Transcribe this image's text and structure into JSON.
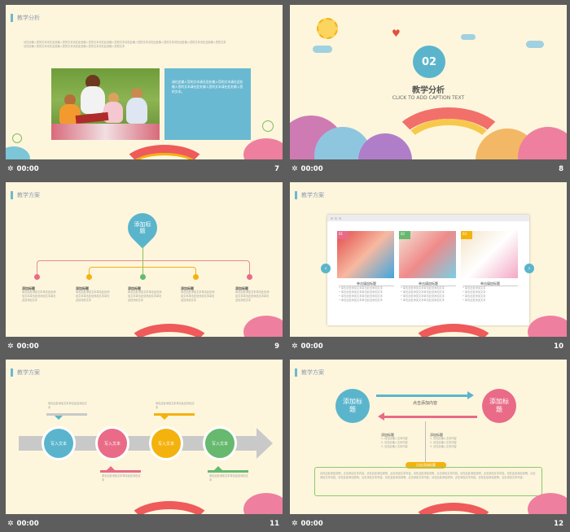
{
  "colors": {
    "bg": "#fdf6dc",
    "blue": "#5ab5cc",
    "pink": "#e96b87",
    "yellow": "#f4b20e",
    "green": "#66b96e",
    "gray": "#c9c9c9",
    "bar": "#5d5d5d"
  },
  "slides": [
    {
      "number": "7",
      "time": "00:00",
      "tag": "教学分析",
      "text1": "请在此输入您的文本请在此处输入您的文本请在此处输入您的文本请在此处输入您的文本",
      "text2": "请在此输入您的文本请在此处输入您的文本请在此处输入您的文本请在此处输入您的文本",
      "text3": "请在此输入您的文本请在此处输入您的文本请在此处输入您的文本请在此处输入您的文本",
      "box_text": "请在此输入您的文本请在此处输入您的文本请在此处输入您的文本请在此处输入您的文本请在此处输入您的文本。"
    },
    {
      "number": "8",
      "time": "00:00",
      "badge": "02",
      "title": "教学分析",
      "subtitle": "CLICK TO ADD CAPTION TEXT"
    },
    {
      "number": "9",
      "time": "00:00",
      "tag": "教学方案",
      "center": "添加标题",
      "items": [
        {
          "label": "添加标题",
          "text": "单击此处添加文本单击此处添加文本单击此处添加文本单击此处添加文本"
        },
        {
          "label": "添加标题",
          "text": "单击此处添加文本单击此处添加文本单击此处添加文本单击此处添加文本"
        },
        {
          "label": "添加标题",
          "text": "单击此处添加文本单击此处添加文本单击此处添加文本单击此处添加文本"
        },
        {
          "label": "添加标题",
          "text": "单击此处添加文本单击此处添加文本单击此处添加文本单击此处添加文本"
        },
        {
          "label": "添加标题",
          "text": "单击此处添加文本单击此处添加文本单击此处添加文本单击此处添加文本"
        }
      ]
    },
    {
      "number": "10",
      "time": "00:00",
      "tag": "教学方案",
      "cards": [
        {
          "num": "01",
          "title": "单击填加标题",
          "lines": [
            "单击此处添加文本单击此处添加文本",
            "单击此处添加文本单击此处添加文本",
            "单击此处添加文本单击此处添加文本",
            "单击此处添加文本单击此处添加文本"
          ]
        },
        {
          "num": "02",
          "title": "单击填加标题",
          "lines": [
            "单击此处添加文本单击此处添加文本",
            "单击此处添加文本单击此处添加文本",
            "单击此处添加文本单击此处添加文本",
            "单击此处添加文本单击此处添加文本"
          ]
        },
        {
          "num": "03",
          "title": "单击填加标题",
          "lines": [
            "单击此处添加文本",
            "单击此处添加文本",
            "单击此处添加文本",
            "单击此处添加文本"
          ]
        }
      ]
    },
    {
      "number": "11",
      "time": "00:00",
      "tag": "教学方案",
      "step_label": "写入文本",
      "notes": [
        "单击此处添加文本单击此处添加文本",
        "单击此处添加文本单击此处添加文本",
        "单击此处添加文本单击此处添加文本",
        "单击此处添加文本单击此处添加文本"
      ]
    },
    {
      "number": "12",
      "time": "00:00",
      "tag": "教学方案",
      "left": "添加标题",
      "right": "添加标题",
      "top_arrow": "点击添加内容",
      "col1": {
        "title": "添加标题",
        "lines": [
          "1. 请在此输入文本内容",
          "2. 请在此输入文本内容",
          "3. 请在此输入文本内容"
        ]
      },
      "col2": {
        "title": "添加标题",
        "lines": [
          "1. 请在此输入文本内容",
          "2. 请在此输入文本内容",
          "3. 请在此输入文本内容"
        ]
      },
      "box_title": "点击添加标题",
      "box_text": "请在此处添加说明，点击添加文本内容。请在此处添加说明，点击添加文本内容。请在此处添加说明，点击添加文本内容。请在此处添加说明，点击添加文本内容。请在此处添加说明，点击添加文本内容。请在此处添加说明，点击添加文本内容。请在此处添加说明，点击添加文本内容。请在此处添加说明，点击添加文本内容。请在此处添加说明，点击添加文本内容。"
    }
  ]
}
